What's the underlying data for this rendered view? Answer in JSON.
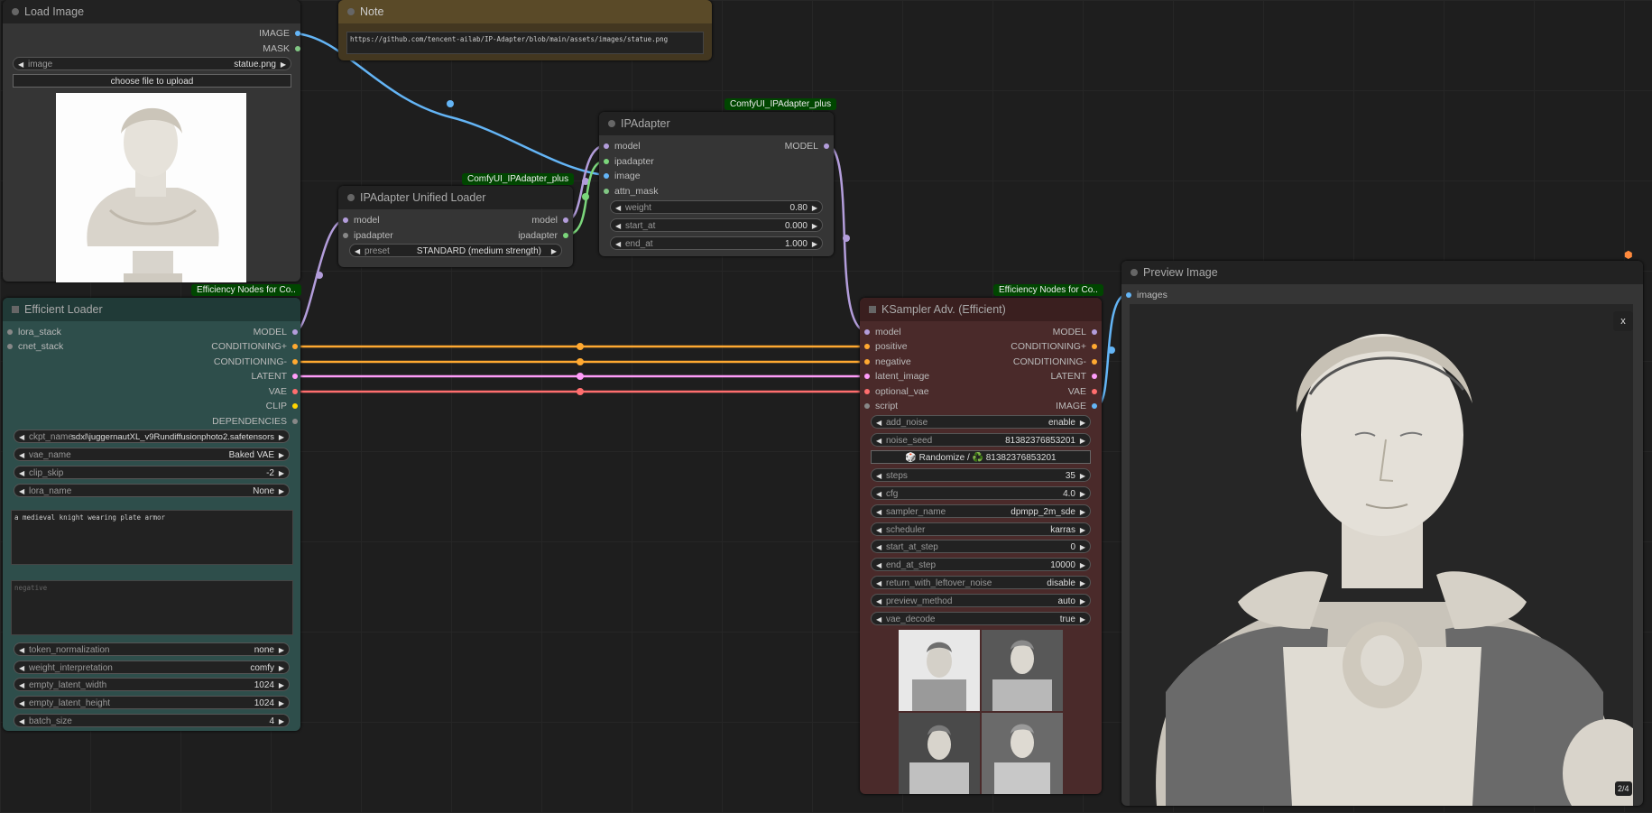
{
  "colors": {
    "model": "#b39ddb",
    "ipadapter": "#7bd67b",
    "image": "#64b5f6",
    "mask": "#81c784",
    "conditioning": "#ffa931",
    "latent": "#ff9cf9",
    "vae": "#ff6e6e",
    "clip": "#ffd500",
    "gray": "#888888",
    "loader_bg": "#2e4e4b",
    "ksampler_bg": "#4a2a2a",
    "badge_bg": "#004600"
  },
  "load_image": {
    "title": "Load Image",
    "out_image": "IMAGE",
    "out_mask": "MASK",
    "image_label": "image",
    "image_value": "statue.png",
    "upload_label": "choose file to upload"
  },
  "note": {
    "title": "Note",
    "text": "https://github.com/tencent-ailab/IP-Adapter/blob/main/assets/images/statue.png"
  },
  "ipadapter": {
    "badge": "ComfyUI_IPAdapter_plus",
    "title": "IPAdapter",
    "in_model": "model",
    "in_ipadapter": "ipadapter",
    "in_image": "image",
    "in_attn_mask": "attn_mask",
    "out_model": "MODEL",
    "weight_label": "weight",
    "weight_value": "0.80",
    "start_at_label": "start_at",
    "start_at_value": "0.000",
    "end_at_label": "end_at",
    "end_at_value": "1.000"
  },
  "unified_loader": {
    "badge": "ComfyUI_IPAdapter_plus",
    "title": "IPAdapter Unified Loader",
    "in_model": "model",
    "in_ipadapter": "ipadapter",
    "out_model": "model",
    "out_ipadapter": "ipadapter",
    "preset_label": "preset",
    "preset_value": "STANDARD (medium strength)"
  },
  "efficient_loader": {
    "badge": "Efficiency Nodes for Co..",
    "title": "Efficient Loader",
    "in_lora_stack": "lora_stack",
    "in_cnet_stack": "cnet_stack",
    "out_model": "MODEL",
    "out_cond_pos": "CONDITIONING+",
    "out_cond_neg": "CONDITIONING-",
    "out_latent": "LATENT",
    "out_vae": "VAE",
    "out_clip": "CLIP",
    "out_deps": "DEPENDENCIES",
    "ckpt_label": "ckpt_name",
    "ckpt_value": "sdxl\\juggernautXL_v9Rundiffusionphoto2.safetensors",
    "vae_label": "vae_name",
    "vae_value": "Baked VAE",
    "clip_skip_label": "clip_skip",
    "clip_skip_value": "-2",
    "lora_label": "lora_name",
    "lora_value": "None",
    "positive_text": "a medieval knight wearing plate armor",
    "negative_placeholder": "negative",
    "token_norm_label": "token_normalization",
    "token_norm_value": "none",
    "weight_interp_label": "weight_interpretation",
    "weight_interp_value": "comfy",
    "width_label": "empty_latent_width",
    "width_value": "1024",
    "height_label": "empty_latent_height",
    "height_value": "1024",
    "batch_label": "batch_size",
    "batch_value": "4"
  },
  "ksampler": {
    "badge": "Efficiency Nodes for Co..",
    "title": "KSampler Adv. (Efficient)",
    "in_model": "model",
    "in_positive": "positive",
    "in_negative": "negative",
    "in_latent": "latent_image",
    "in_vae": "optional_vae",
    "in_script": "script",
    "out_model": "MODEL",
    "out_cond_pos": "CONDITIONING+",
    "out_cond_neg": "CONDITIONING-",
    "out_latent": "LATENT",
    "out_vae": "VAE",
    "out_image": "IMAGE",
    "add_noise_label": "add_noise",
    "add_noise_value": "enable",
    "noise_seed_label": "noise_seed",
    "noise_seed_value": "81382376853201",
    "randomize_label": "🎲 Randomize / ♻️ 81382376853201",
    "steps_label": "steps",
    "steps_value": "35",
    "cfg_label": "cfg",
    "cfg_value": "4.0",
    "sampler_label": "sampler_name",
    "sampler_value": "dpmpp_2m_sde",
    "scheduler_label": "scheduler",
    "scheduler_value": "karras",
    "start_label": "start_at_step",
    "start_value": "0",
    "end_label": "end_at_step",
    "end_value": "10000",
    "leftover_label": "return_with_leftover_noise",
    "leftover_value": "disable",
    "preview_label": "preview_method",
    "preview_value": "auto",
    "vae_decode_label": "vae_decode",
    "vae_decode_value": "true"
  },
  "preview": {
    "title": "Preview Image",
    "in_images": "images",
    "close": "x",
    "counter": "2/4"
  }
}
